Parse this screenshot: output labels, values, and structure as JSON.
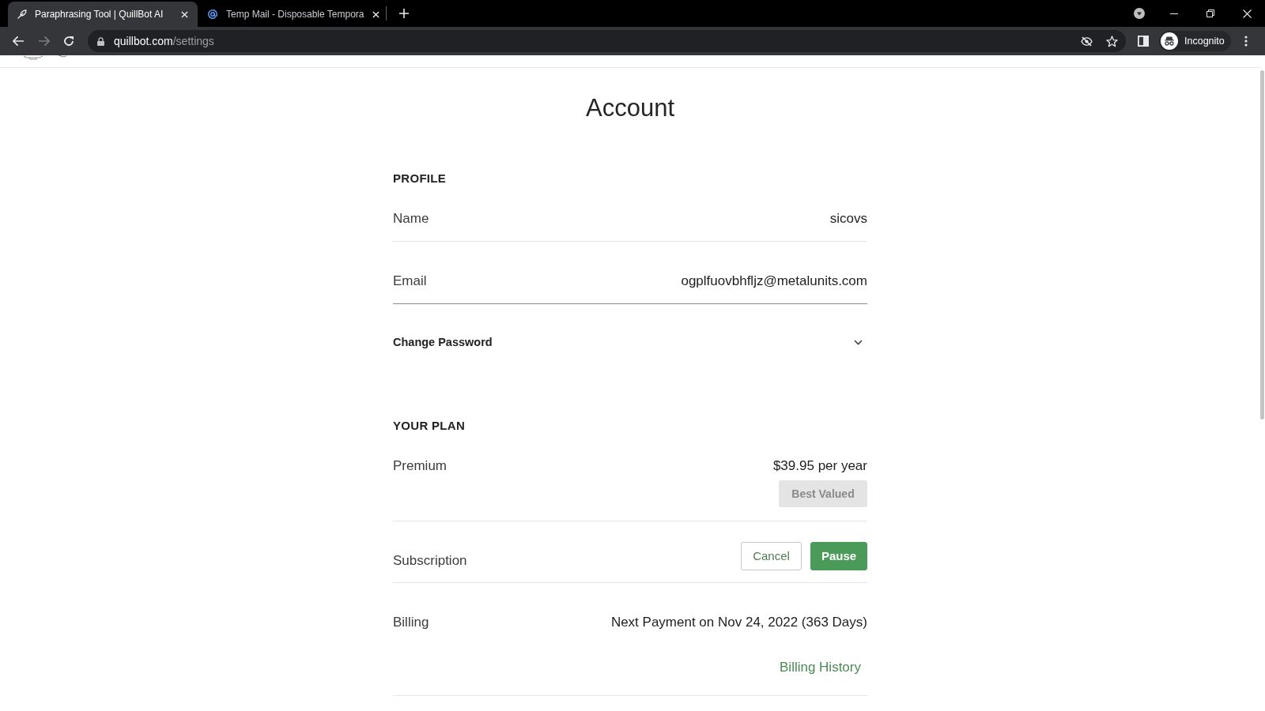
{
  "browser": {
    "tabs": [
      {
        "title": "Paraphrasing Tool | QuillBot AI",
        "selected": true
      },
      {
        "title": "Temp Mail - Disposable Tempora",
        "selected": false
      }
    ],
    "address": {
      "host": "quillbot.com",
      "path": "/settings"
    },
    "profile_label": "Incognito"
  },
  "page": {
    "title": "Account",
    "sections": [
      {
        "heading": "PROFILE",
        "rows": [
          {
            "kind": "field",
            "label": "Name",
            "value": "sicovs",
            "focused": false
          },
          {
            "kind": "field",
            "label": "Email",
            "value": "ogplfuovbhfljz@metalunits.com",
            "focused": true
          },
          {
            "kind": "expander",
            "label": "Change Password",
            "expanded": false
          }
        ]
      },
      {
        "heading": "YOUR PLAN",
        "rows": [
          {
            "kind": "plan",
            "label": "Premium",
            "value": "$39.95 per year",
            "badge": {
              "label": "Best Valued",
              "disabled": true
            }
          },
          {
            "kind": "actions",
            "label": "Subscription",
            "buttons": [
              {
                "label": "Cancel",
                "kind": "outline"
              },
              {
                "label": "Pause",
                "kind": "primary"
              }
            ]
          },
          {
            "kind": "billing",
            "label": "Billing",
            "value": "Next Payment on Nov 24, 2022 (363 Days)",
            "link": "Billing History"
          }
        ]
      }
    ]
  }
}
